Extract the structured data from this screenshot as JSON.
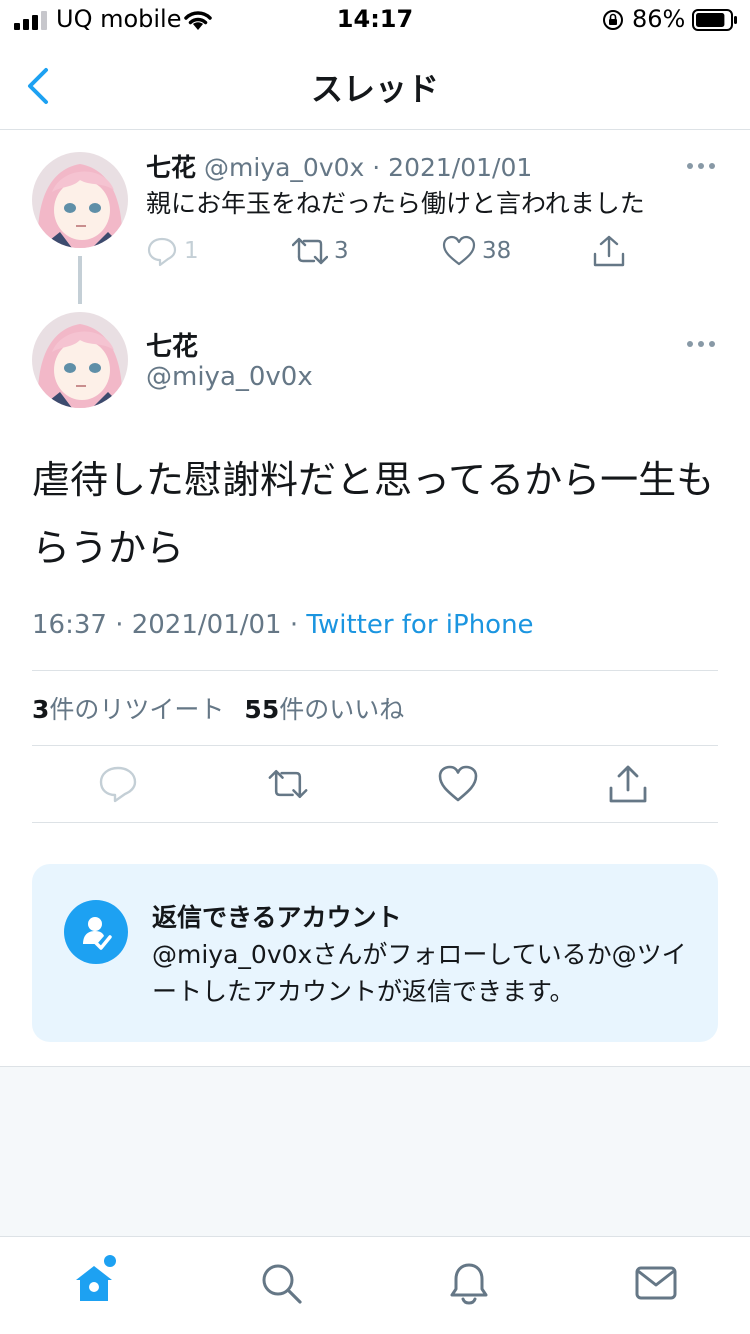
{
  "status_bar": {
    "carrier": "UQ mobile",
    "time": "14:17",
    "battery_percent": "86%",
    "battery_level": 0.86
  },
  "nav": {
    "title": "スレッド"
  },
  "parent_tweet": {
    "name": "七花",
    "meta": "@miya_0v0x · 2021/01/01",
    "text": "親にお年玉をねだったら働けと言われました",
    "reply_count": "1",
    "retweet_count": "3",
    "like_count": "38"
  },
  "main_tweet": {
    "name": "七花",
    "handle": "@miya_0v0x",
    "text": "虐待した慰謝料だと思ってるから一生もらうから",
    "timestamp": "16:37 · 2021/01/01 · ",
    "source": "Twitter for iPhone",
    "retweets_num": "3",
    "retweets_label": "件のリツイート",
    "likes_num": "55",
    "likes_label": "件のいいね"
  },
  "reply_card": {
    "title": "返信できるアカウント",
    "body": "@miya_0v0xさんがフォローしているか@ツイートしたアカウントが返信できます。"
  },
  "colors": {
    "accent": "#1da1f2",
    "link": "#1b95e0",
    "secondary_text": "#657786",
    "card_bg": "#e8f5fe"
  },
  "icons": {
    "tabs": [
      "home-icon",
      "search-icon",
      "notifications-icon",
      "messages-icon"
    ]
  }
}
